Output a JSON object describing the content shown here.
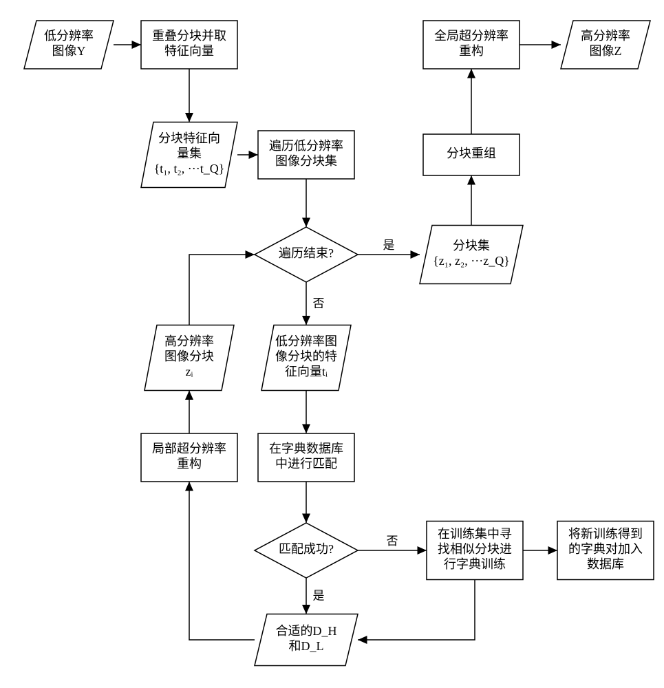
{
  "nodes": {
    "input_y": {
      "type": "para",
      "l1": "低分辨率",
      "l2": "图像Y"
    },
    "overlap_block": {
      "type": "rect",
      "l1": "重叠分块并取",
      "l2": "特征向量"
    },
    "global_recon": {
      "type": "rect",
      "l1": "全局超分辨率",
      "l2": "重构"
    },
    "output_z": {
      "type": "para",
      "l1": "高分辨率",
      "l2": "图像Z"
    },
    "feat_set": {
      "type": "para",
      "l1": "分块特征向",
      "l2": "量集",
      "l3": "{t₁, t₂, ···t_Q}"
    },
    "traverse": {
      "type": "rect",
      "l1": "遍历低分辨率",
      "l2": "图像分块集"
    },
    "block_regroup": {
      "type": "rect",
      "l1": "分块重组"
    },
    "done_q": {
      "type": "diamond",
      "l1": "遍历结束?"
    },
    "block_set_z": {
      "type": "para",
      "l1": "分块集",
      "l2": "{z₁, z₂, ···z_Q}"
    },
    "hi_block_zi": {
      "type": "para",
      "l1": "高分辨率",
      "l2": "图像分块",
      "l3": "zᵢ"
    },
    "lo_feat_ti": {
      "type": "para",
      "l1": "低分辨率图",
      "l2": "像分块的特",
      "l3": "征向量tᵢ"
    },
    "local_recon": {
      "type": "rect",
      "l1": "局部超分辨率",
      "l2": "重构"
    },
    "dict_match": {
      "type": "rect",
      "l1": "在字典数据库",
      "l2": "中进行匹配"
    },
    "match_q": {
      "type": "diamond",
      "l1": "匹配成功?"
    },
    "train_new": {
      "type": "rect",
      "l1": "在训练集中寻",
      "l2": "找相似分块进",
      "l3": "行字典训练"
    },
    "add_db": {
      "type": "rect",
      "l1": "将新训练得到",
      "l2": "的字典对加入",
      "l3": "数据库"
    },
    "dh_dl": {
      "type": "para",
      "l1": "合适的D_H",
      "l2": "和D_L"
    }
  },
  "edge_labels": {
    "yes1": "是",
    "no1": "否",
    "yes2": "是",
    "no2": "否"
  }
}
